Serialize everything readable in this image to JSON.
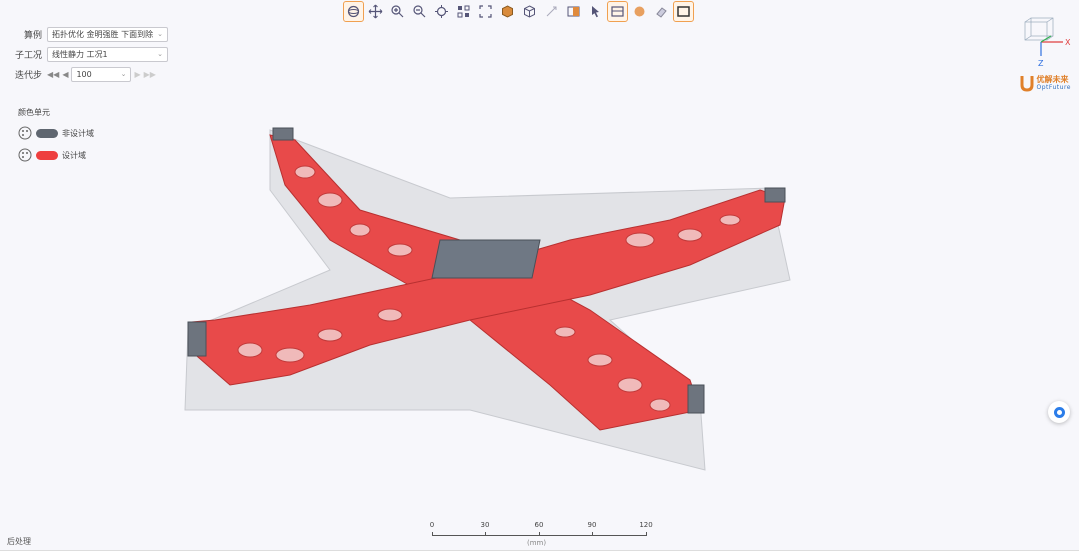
{
  "toolbar": {
    "buttons": [
      {
        "icon": "rotate-icon",
        "active": true
      },
      {
        "icon": "pan-icon",
        "active": false
      },
      {
        "icon": "zoom-in-icon",
        "active": false
      },
      {
        "icon": "zoom-out-icon",
        "active": false
      },
      {
        "icon": "fit-view-icon",
        "active": false
      },
      {
        "icon": "select-icon",
        "active": false
      },
      {
        "icon": "frame-icon",
        "active": false
      },
      {
        "icon": "solid-cube-icon",
        "active": false
      },
      {
        "icon": "wire-cube-icon",
        "active": false
      },
      {
        "icon": "probe-icon",
        "active": false
      },
      {
        "icon": "section-icon",
        "active": false
      },
      {
        "icon": "pointer-icon",
        "active": false
      },
      {
        "icon": "bounds-icon",
        "active": true
      },
      {
        "icon": "shading-icon",
        "active": false
      },
      {
        "icon": "eraser-icon",
        "active": false
      },
      {
        "icon": "display-icon",
        "active": true
      }
    ]
  },
  "panel": {
    "case_label": "算例",
    "case_value": "拓扑优化 金明强胜 下面到除",
    "subcase_label": "子工况",
    "subcase_value": "线性静力 工况1",
    "iteration_label": "迭代步",
    "iteration_value": "100"
  },
  "legend": {
    "title": "颜色单元",
    "items": [
      {
        "label": "非设计域",
        "color": "#5f6670"
      },
      {
        "label": "设计域",
        "color": "#ee3f3f"
      }
    ]
  },
  "logo": {
    "text": "优解未来",
    "sub": "OptFuture"
  },
  "axes": {
    "x": "X",
    "z": "Z"
  },
  "scale": {
    "ticks": [
      "0",
      "30",
      "60",
      "90",
      "120"
    ],
    "unit": "(mm)"
  },
  "status": "后处理"
}
